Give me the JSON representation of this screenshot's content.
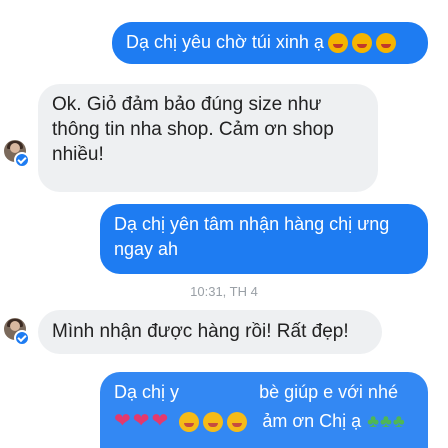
{
  "messages": {
    "m1": "Dạ chị yêu chờ túi xinh ạ",
    "m2": "Ok. Giỏ đảm bảo đúng size như thông tin nha shop. Cảm ơn shop nhiều!",
    "m3": "Dạ chị yên tâm nhận hàng chị ưng ngay ah",
    "timestamp": "10:31, TH 4",
    "m4": "Mình nhận được hàng rồi! Rất đẹp!",
    "m5_line1": "Dạ chị y",
    "m5_line1b": "bè giúp e với nhé",
    "m5_line2": "ảm ơn Chị ạ"
  },
  "icons": {
    "avatar": "sender-avatar",
    "verified": "messenger-badge-icon",
    "emoji": "laughing-face-emoji",
    "heart": "heart-emoji",
    "clover": "clover-emoji"
  },
  "colors": {
    "outgoing": "#1e7cf2",
    "incoming": "#eef0f2",
    "timestamp": "#9aa0a6"
  }
}
